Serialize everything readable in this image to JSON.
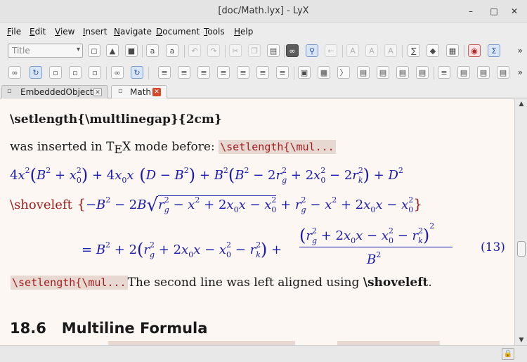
{
  "window": {
    "title": "[doc/Math.lyx] - LyX",
    "minimize": "–",
    "maximize": "□",
    "close": "✕"
  },
  "menu": [
    {
      "label": "File",
      "key": "F",
      "rest": "ile"
    },
    {
      "label": "Edit",
      "key": "E",
      "rest": "dit"
    },
    {
      "label": "View",
      "key": "V",
      "rest": "iew"
    },
    {
      "label": "Insert",
      "key": "I",
      "rest": "nsert"
    },
    {
      "label": "Navigate",
      "key": "N",
      "rest": "avigate"
    },
    {
      "label": "Document",
      "key": "D",
      "rest": "ocument"
    },
    {
      "label": "Tools",
      "key": "T",
      "rest": "ools"
    },
    {
      "label": "Help",
      "key": "H",
      "rest": "elp"
    }
  ],
  "toolbar": {
    "layout_value": "Title",
    "more": "»"
  },
  "tabs": [
    {
      "label": "EmbeddedObjects",
      "close": "✕"
    },
    {
      "label": "Math",
      "close": "✕"
    }
  ],
  "doc": {
    "heading_cmd": "\\setlength{\\multlinegap}{2cm}",
    "para1": "was inserted in T",
    "para1_e": "E",
    "para1_x": "X mode before:",
    "ert1": "\\setlength{\\mul...",
    "shoveleft_cmd": "\\shoveleft",
    "eq_number": "(13)",
    "ert2": "\\setlength{\\mul...",
    "para2_a": "The second line was left aligned using ",
    "para2_b": "\\shoveleft",
    "para2_c": ".",
    "section_number": "18.6",
    "section_title": "Multiline Formula"
  },
  "statusbar": {
    "lock_icon": "lock-icon"
  }
}
